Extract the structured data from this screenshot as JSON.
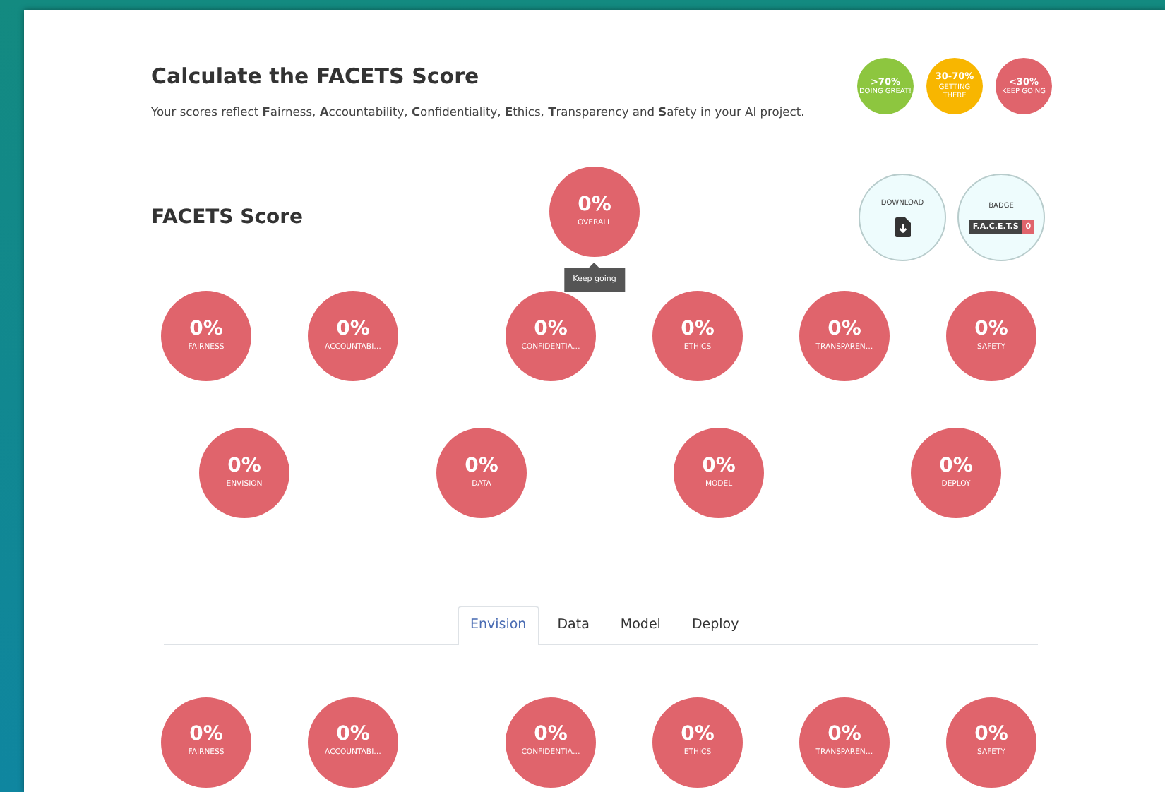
{
  "header": {
    "title": "Calculate the FACETS Score",
    "description": "Your scores reflect **F**airness, **A**ccountability, **C**onfidentiality, **E**thics, **T**ransparency and **S**afety in your AI project."
  },
  "legend": [
    {
      "range": ">70%",
      "label": "DOING GREAT!",
      "color": "#8dc63f"
    },
    {
      "range": "30-70%",
      "label": "GETTING THERE",
      "color": "#f8b600"
    },
    {
      "range": "<30%",
      "label": "KEEP GOING",
      "color": "#e0646c"
    }
  ],
  "score_section": {
    "title": "FACETS Score",
    "overall": {
      "value": "0%",
      "label": "OVERALL",
      "tooltip": "Keep going"
    },
    "actions": [
      {
        "kind": "download",
        "label": "DOWNLOAD"
      },
      {
        "kind": "badge",
        "label": "BADGE",
        "badge_text": "F.A.C.E.T.S",
        "badge_value": "0"
      }
    ],
    "facets": [
      {
        "value": "0%",
        "label": "FAIRNESS"
      },
      {
        "value": "0%",
        "label": "ACCOUNTABI…"
      },
      {
        "value": "0%",
        "label": "CONFIDENTIA…"
      },
      {
        "value": "0%",
        "label": "ETHICS"
      },
      {
        "value": "0%",
        "label": "TRANSPAREN…"
      },
      {
        "value": "0%",
        "label": "SAFETY"
      }
    ],
    "phases": [
      {
        "value": "0%",
        "label": "ENVISION"
      },
      {
        "value": "0%",
        "label": "DATA"
      },
      {
        "value": "0%",
        "label": "MODEL"
      },
      {
        "value": "0%",
        "label": "DEPLOY"
      }
    ]
  },
  "tabs": [
    {
      "label": "Envision",
      "selected": true
    },
    {
      "label": "Data",
      "selected": false
    },
    {
      "label": "Model",
      "selected": false
    },
    {
      "label": "Deploy",
      "selected": false
    }
  ],
  "tab_facets": [
    {
      "value": "0%",
      "label": "FAIRNESS"
    },
    {
      "value": "0%",
      "label": "ACCOUNTABI…"
    },
    {
      "value": "0%",
      "label": "CONFIDENTIA…"
    },
    {
      "value": "0%",
      "label": "ETHICS"
    },
    {
      "value": "0%",
      "label": "TRANSPAREN…"
    },
    {
      "value": "0%",
      "label": "SAFETY"
    }
  ]
}
